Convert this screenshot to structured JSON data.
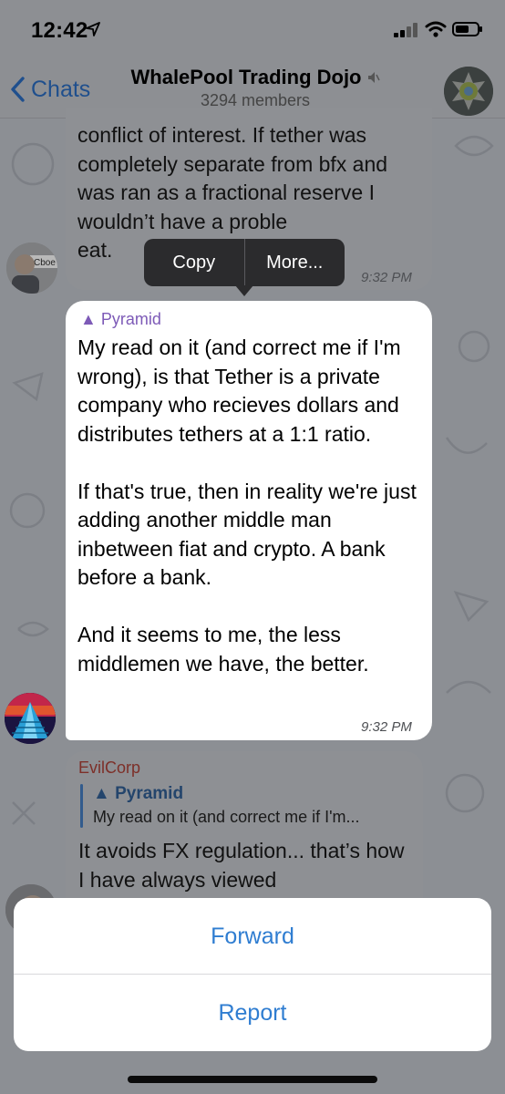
{
  "status_bar": {
    "time": "12:42"
  },
  "nav": {
    "back_label": "Chats",
    "title": "WhalePool Trading Dojo",
    "subtitle": "3294 members"
  },
  "messages": [
    {
      "avatar_label": "Cboe",
      "text": "conflict of interest. If tether was completely separate from bfx and was ran as a fractional reserve I wouldn’t have a proble",
      "text_tail": "eat.",
      "time": "9:32 PM"
    },
    {
      "sender": "▲ Pyramid",
      "text": "My read on it (and correct me if I'm wrong), is that Tether is a private company who recieves dollars and distributes tethers at a 1:1 ratio.\n\nIf that's true, then in reality we're just adding another middle man inbetween fiat and crypto. A bank before a bank.\n\nAnd it seems to me, the less middlemen we have, the better.",
      "time": "9:32 PM"
    },
    {
      "sender": "EvilCorp",
      "reply_name": "▲ Pyramid",
      "reply_text": "My read on it (and correct me if I'm...",
      "text": "It avoids FX regulation... that’s how I have always viewed"
    }
  ],
  "context_menu": {
    "copy": "Copy",
    "more": "More..."
  },
  "action_sheet": {
    "forward": "Forward",
    "report": "Report"
  },
  "colors": {
    "accent": "#2f7dd1",
    "pyramid": "#7d5ab7",
    "evilcorp": "#c0392b"
  }
}
